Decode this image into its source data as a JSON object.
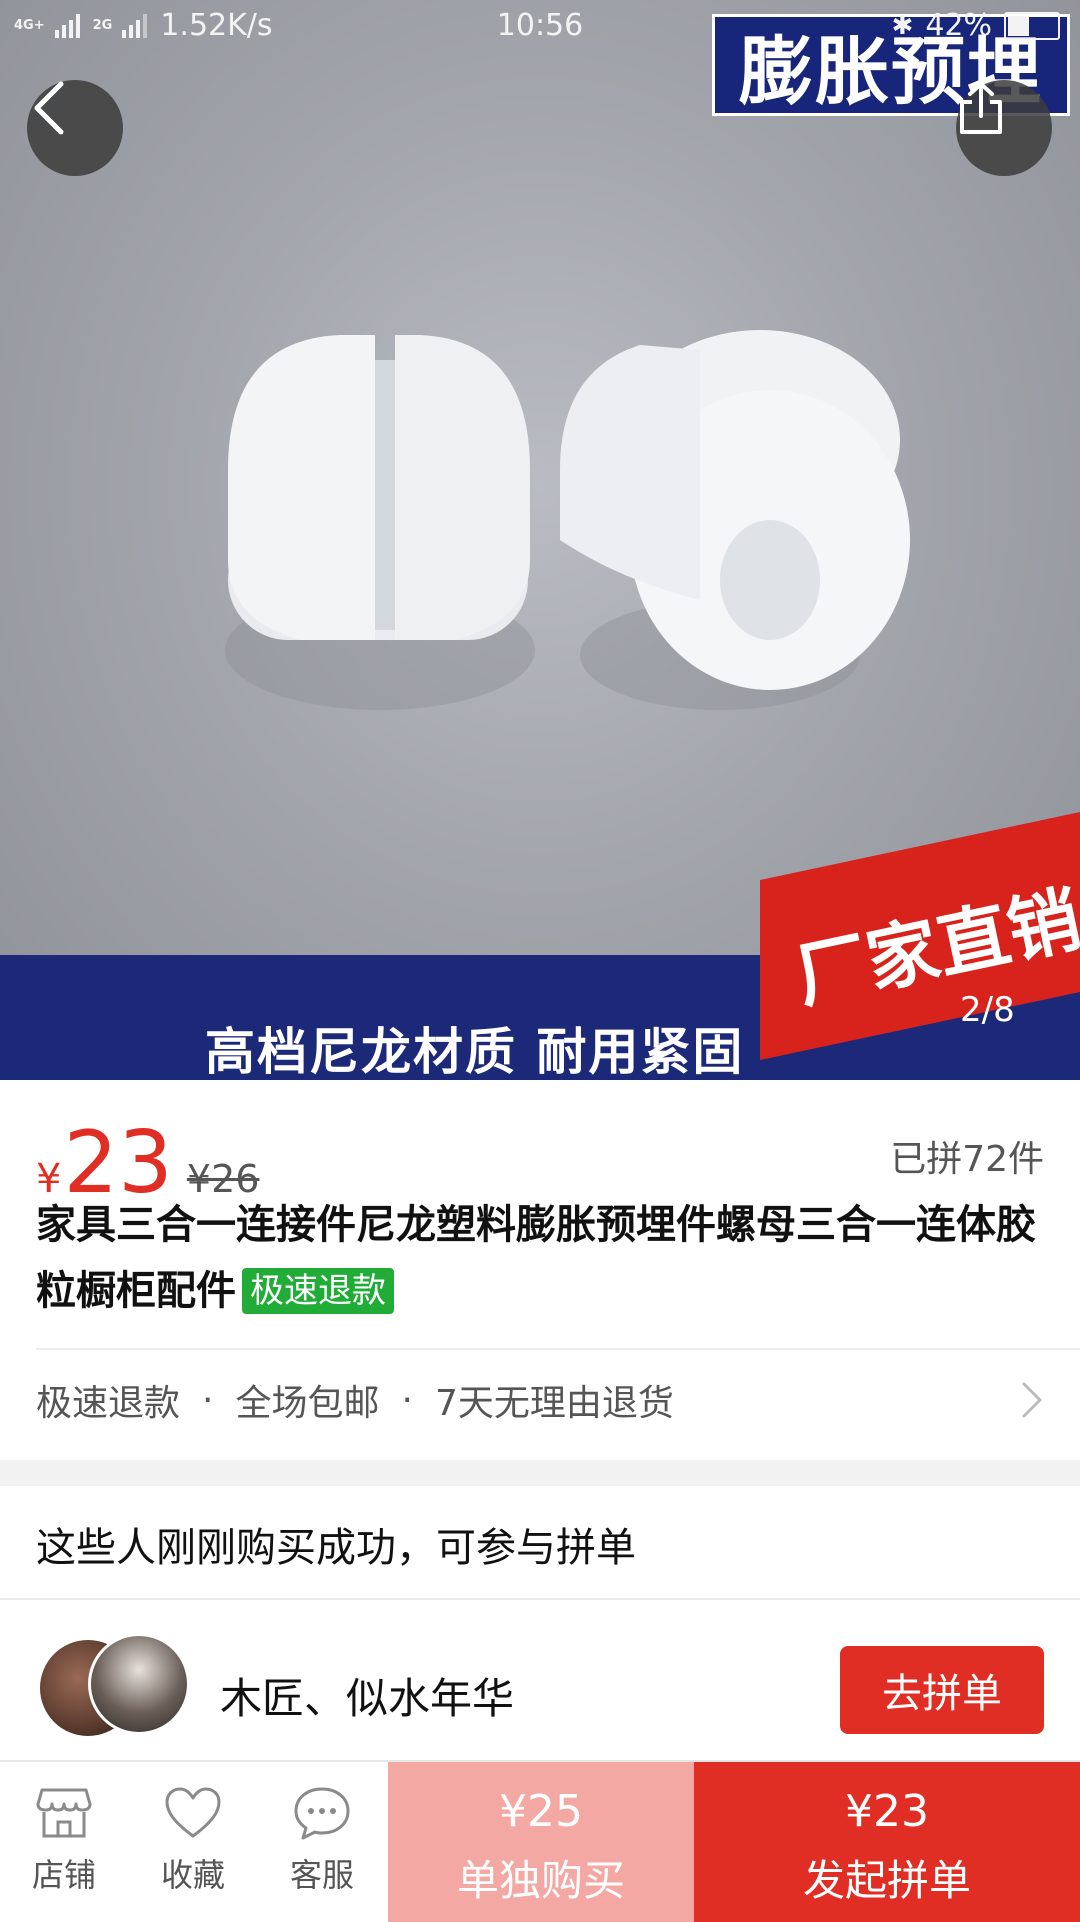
{
  "status_bar": {
    "network_1": "4G+",
    "network_2": "4G+ 2G",
    "network_3": "2G",
    "speed": "1.52K/s",
    "time": "10:56",
    "battery": "42%"
  },
  "hero": {
    "badge_top": "膨胀预埋",
    "ribbon": "厂家直销",
    "band": "高档尼龙材质  耐用紧固",
    "counter": "2/8"
  },
  "product": {
    "currency": "¥",
    "price": "23",
    "original_price": "¥26",
    "sold": "已拼72件",
    "title": "家具三合一连接件尼龙塑料膨胀预埋件螺母三合一连体胶粒橱柜配件",
    "tag": "极速退款",
    "services": [
      "极速退款",
      "全场包邮",
      "7天无理由退货"
    ],
    "service_sep": "·"
  },
  "group_buy": {
    "section_title": "这些人刚刚购买成功，可参与拼单",
    "buyer_name": "木匠、似水年华",
    "join_label": "去拼单"
  },
  "bottom_bar": {
    "shop_label": "店铺",
    "fav_label": "收藏",
    "cs_label": "客服",
    "single_price": "¥25",
    "single_label": "单独购买",
    "group_price": "¥23",
    "group_label": "发起拼单"
  },
  "colors": {
    "accent_red": "#e02e24",
    "light_red": "#f4a8a4",
    "tag_green": "#21ac38"
  }
}
